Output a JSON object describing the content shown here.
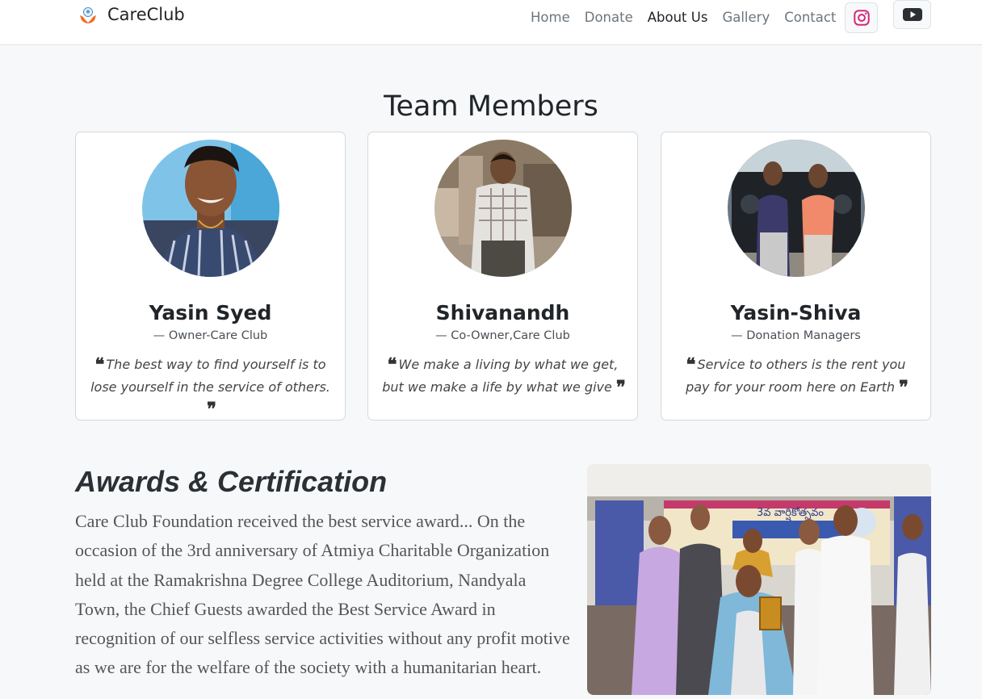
{
  "navbar": {
    "brand_name": "CareClub",
    "links": [
      {
        "label": "Home",
        "active": false
      },
      {
        "label": "Donate",
        "active": false
      },
      {
        "label": "About Us",
        "active": true
      },
      {
        "label": "Gallery",
        "active": false
      },
      {
        "label": "Contact",
        "active": false
      }
    ],
    "social": [
      "instagram-icon",
      "youtube-icon"
    ]
  },
  "team": {
    "title": "Team Members",
    "members": [
      {
        "name": "Yasin Syed",
        "role": "— Owner-Care Club",
        "quote": "The best way to find yourself is to lose yourself in the service of others."
      },
      {
        "name": "Shivanandh",
        "role": "— Co-Owner,Care Club",
        "quote": "We make a living by what we get, but we make a life by what we give"
      },
      {
        "name": "Yasin-Shiva",
        "role": "— Donation Managers",
        "quote": "Service to others is the rent you pay for your room here on Earth"
      }
    ]
  },
  "awards": {
    "title": "Awards & Certification",
    "text": "Care Club Foundation received the best service award... On the occasion of the 3rd anniversary of Atmiya Charitable Organization held at the Ramakrishna Degree College Auditorium, Nandyala Town, the Chief Guests awarded the Best Service Award in recognition of our selfless service activities without any profit motive as we are for the welfare of the society with a humanitarian heart.",
    "banner_text": "3వ వార్షికోత్సవం"
  },
  "colors": {
    "instagram": "#d62976",
    "youtube": "#212529",
    "nav_active": "#212529",
    "nav_muted": "#6c757d"
  }
}
